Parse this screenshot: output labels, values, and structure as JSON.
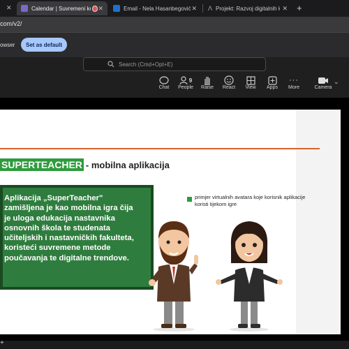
{
  "tabs": [
    {
      "label": "Calendar | Suvremeni kon",
      "active": true
    },
    {
      "label": "Email - Nela Hasanbegović -",
      "active": false
    },
    {
      "label": "Projekt: Razvoj digitalnih kon",
      "active": false
    }
  ],
  "new_tab_symbol": "+",
  "address": {
    "url_fragment": "com/v2/"
  },
  "infobar": {
    "text": "owser",
    "set_default_label": "Set as default"
  },
  "meeting": {
    "search_placeholder": "Search (Cmd+Opt+E)",
    "tools": [
      {
        "label": "Chat",
        "icon": "chat-icon"
      },
      {
        "label": "People",
        "icon": "people-icon",
        "badge": "9"
      },
      {
        "label": "Raise",
        "icon": "raise-hand-icon"
      },
      {
        "label": "React",
        "icon": "react-icon"
      },
      {
        "label": "View",
        "icon": "view-icon"
      },
      {
        "label": "Apps",
        "icon": "apps-icon"
      },
      {
        "label": "More",
        "icon": "more-icon"
      },
      {
        "label": "Camera",
        "icon": "camera-icon"
      }
    ]
  },
  "slide": {
    "title_highlight": "SUPERTEACHER",
    "title_rest": "- mobilna aplikacija",
    "board_lines": [
      "Aplikacija „SuperTeacher\"",
      "zamišljena je kao mobilna igra čija",
      "je uloga edukacija nastavnika",
      "osnovnih škola te studenata",
      "učiteljskih i nastavničkih fakulteta,",
      "koristeći suvremene metode",
      "poučavanja te digitalne trendove."
    ],
    "caption": "primjer virtualnih avatara koje korisnik aplikacije koristi tijekom igre"
  },
  "colors": {
    "accent_green": "#2e9b3c",
    "rule_orange": "#d9622b",
    "default_btn": "#a8c7fa"
  }
}
